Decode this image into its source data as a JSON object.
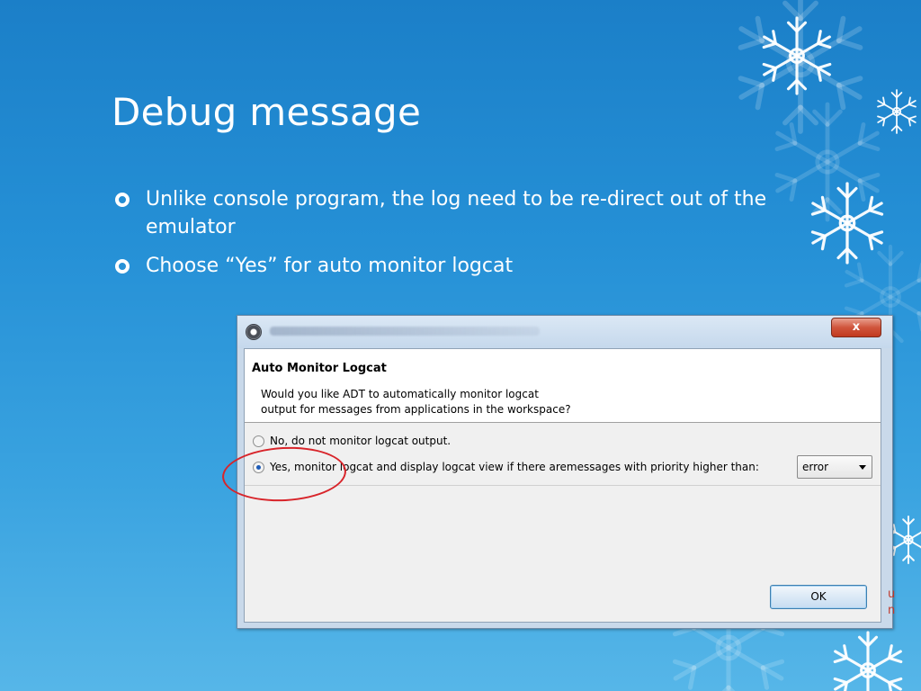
{
  "slide": {
    "title": "Debug message",
    "bullets": [
      "Unlike console program, the log need to be re-direct out of the emulator",
      "Choose “Yes” for auto monitor logcat"
    ]
  },
  "dialog": {
    "close_label": "x",
    "heading": "Auto Monitor Logcat",
    "description_lines": [
      "Would you like ADT to automatically monitor logcat",
      "output for messages from applications in the workspace?"
    ],
    "options": [
      {
        "label": "No, do not monitor logcat output.",
        "checked": false
      },
      {
        "label": "Yes, monitor logcat and display logcat view if there aremessages with priority higher than:",
        "checked": true
      }
    ],
    "priority_value": "error",
    "ok_label": "OK"
  },
  "edge_text": [
    "u",
    "n"
  ],
  "colors": {
    "background": "#2590d6",
    "annotation": "#d8242a",
    "close_button": "#c1391f",
    "ok_border": "#3c7fb1"
  },
  "icons": [
    "bullet-circle-icon",
    "snowflake-icon",
    "app-icon",
    "close-icon",
    "dropdown-arrow-icon"
  ]
}
